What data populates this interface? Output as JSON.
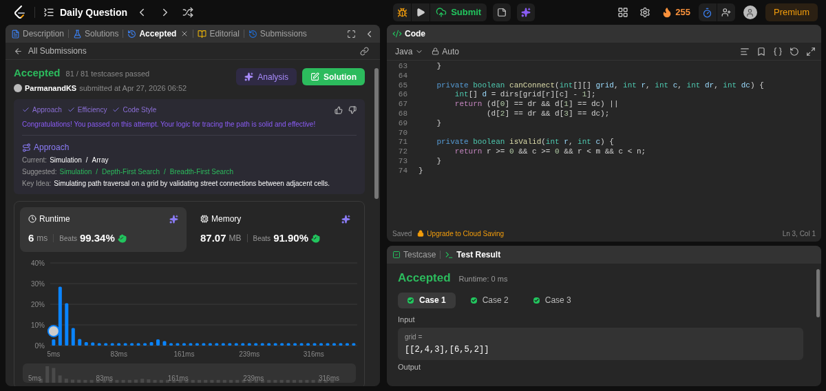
{
  "navbar": {
    "title": "Daily Question",
    "submit": "Submit",
    "streak": "255",
    "premium": "Premium"
  },
  "left_tabs": [
    {
      "label": "Description",
      "kind": "description",
      "selected": false,
      "closable": false
    },
    {
      "label": "Solutions",
      "kind": "solutions",
      "selected": false,
      "closable": false
    },
    {
      "label": "Accepted",
      "kind": "accepted",
      "selected": true,
      "closable": true
    },
    {
      "label": "Editorial",
      "kind": "editorial",
      "selected": false,
      "closable": false
    },
    {
      "label": "Submissions",
      "kind": "submissions",
      "selected": false,
      "closable": false
    }
  ],
  "submission": {
    "back": "All Submissions",
    "status": "Accepted",
    "testcases": "81 / 81 testcases passed",
    "user": "ParmanandKS",
    "submitted": "submitted at Apr 27, 2026 06:52",
    "analysis_button": "Analysis",
    "solution_button": "Solution"
  },
  "feedback": {
    "checks": [
      {
        "label": "Approach",
        "checked": true
      },
      {
        "label": "Efficiency",
        "checked": true
      },
      {
        "label": "Code Style",
        "checked": true
      }
    ],
    "message": "Congratulations! You passed on this attempt. Your logic for tracing the path is solid and effective!",
    "approach_title": "Approach",
    "separator": "/",
    "current_label": "Current:",
    "current": [
      "Simulation",
      "Array"
    ],
    "suggested_label": "Suggested:",
    "suggested": [
      "Simulation",
      "Depth-First Search",
      "Breadth-First Search"
    ],
    "key_idea_label": "Key Idea:",
    "key_idea": "Simulating path traversal on a grid by validating street connections between adjacent cells."
  },
  "stats": [
    {
      "kind": "runtime",
      "label": "Runtime",
      "value": "6",
      "unit": "ms",
      "beats_label": "Beats",
      "beats": "99.34%",
      "selected": true
    },
    {
      "kind": "memory",
      "label": "Memory",
      "value": "87.07",
      "unit": "MB",
      "beats_label": "Beats",
      "beats": "91.90%",
      "selected": false
    }
  ],
  "chart_data": {
    "type": "bar",
    "grid": true,
    "ylim": [
      0,
      40
    ],
    "yticks": [
      {
        "value": 0,
        "label": "0%"
      },
      {
        "value": 10,
        "label": "10%"
      },
      {
        "value": 20,
        "label": "20%"
      },
      {
        "value": 30,
        "label": "30%"
      },
      {
        "value": 40,
        "label": "40%"
      }
    ],
    "xlim": [
      1,
      368
    ],
    "xticks": [
      {
        "value": 5,
        "label": "5ms"
      },
      {
        "value": 83,
        "label": "83ms"
      },
      {
        "value": 161,
        "label": "161ms"
      },
      {
        "value": 239,
        "label": "239ms"
      },
      {
        "value": 316,
        "label": "316ms"
      }
    ],
    "x": [
      5,
      12.8,
      20.6,
      28.4,
      36.2,
      44,
      51.8,
      59.6,
      67.4,
      75.2,
      83,
      90.8,
      98.6,
      106.4,
      114.2,
      122,
      129.8,
      137.6,
      145.4,
      153.2,
      161,
      168.8,
      176.6,
      184.4,
      192.2,
      200,
      207.8,
      215.6,
      223.4,
      231.2,
      239,
      246.8,
      254.6,
      262.4,
      270.2,
      278,
      285.8,
      293.6,
      301.4,
      309.2,
      317,
      324.8,
      332.6,
      340.4,
      348.2,
      356,
      363.8
    ],
    "values": [
      3,
      28.5,
      20.5,
      8.5,
      3.2,
      1.7,
      1.5,
      1.2,
      1.2,
      1.2,
      1.2,
      1.2,
      1.2,
      1.2,
      1.2,
      1.7,
      3,
      2.2,
      1.2,
      1.2,
      1.2,
      1.2,
      1.2,
      1.2,
      1.2,
      1.2,
      1.2,
      1.2,
      1.2,
      1.2,
      1.2,
      1.2,
      1.2,
      1.2,
      1.2,
      1.2,
      1.2,
      1.2,
      1.2,
      1.2,
      1.2,
      1.2,
      1.2,
      1.2,
      1.2,
      1.2,
      1.2
    ]
  },
  "overview_labels": [
    "5ms",
    "83ms",
    "161ms",
    "239ms",
    "316ms"
  ],
  "code": {
    "title": "Code",
    "language": "Java",
    "mode": "Auto",
    "saved": "Saved",
    "upgrade": "Upgrade to Cloud Saving",
    "position": "Ln 3, Col 1",
    "lines": [
      {
        "n": "63",
        "tokens": [
          {
            "t": "    }",
            "kind": "p"
          }
        ]
      },
      {
        "n": "64"
      },
      {
        "n": "65",
        "tokens": [
          {
            "t": "    private ",
            "kind": "kw"
          },
          {
            "t": "boolean ",
            "kind": "type"
          },
          {
            "t": "canConnect",
            "kind": "fn"
          },
          {
            "t": "(",
            "kind": "p"
          },
          {
            "t": "int",
            "kind": "type"
          },
          {
            "t": "[][] ",
            "kind": "p"
          },
          {
            "t": "grid",
            "kind": "var"
          },
          {
            "t": ", ",
            "kind": "p"
          },
          {
            "t": "int ",
            "kind": "type"
          },
          {
            "t": "r",
            "kind": "var"
          },
          {
            "t": ", ",
            "kind": "p"
          },
          {
            "t": "int ",
            "kind": "type"
          },
          {
            "t": "c",
            "kind": "var"
          },
          {
            "t": ", ",
            "kind": "p"
          },
          {
            "t": "int ",
            "kind": "type"
          },
          {
            "t": "dr",
            "kind": "var"
          },
          {
            "t": ", ",
            "kind": "p"
          },
          {
            "t": "int ",
            "kind": "type"
          },
          {
            "t": "dc",
            "kind": "var"
          },
          {
            "t": ") {",
            "kind": "p"
          }
        ]
      },
      {
        "n": "66",
        "tokens": [
          {
            "t": "        int",
            "kind": "type"
          },
          {
            "t": "[] ",
            "kind": "p"
          },
          {
            "t": "d",
            "kind": "var"
          },
          {
            "t": " = dirs[grid[r][c] - ",
            "kind": "p"
          },
          {
            "t": "1",
            "kind": "num"
          },
          {
            "t": "];",
            "kind": "p"
          }
        ]
      },
      {
        "n": "67",
        "tokens": [
          {
            "t": "        return ",
            "kind": "ctl"
          },
          {
            "t": "(d[",
            "kind": "p"
          },
          {
            "t": "0",
            "kind": "num"
          },
          {
            "t": "] == dr && d[",
            "kind": "p"
          },
          {
            "t": "1",
            "kind": "num"
          },
          {
            "t": "] == dc) ||",
            "kind": "p"
          }
        ]
      },
      {
        "n": "68",
        "tokens": [
          {
            "t": "               (d[",
            "kind": "p"
          },
          {
            "t": "2",
            "kind": "num"
          },
          {
            "t": "] == dr && d[",
            "kind": "p"
          },
          {
            "t": "3",
            "kind": "num"
          },
          {
            "t": "] == dc);",
            "kind": "p"
          }
        ]
      },
      {
        "n": "69",
        "tokens": [
          {
            "t": "    }",
            "kind": "p"
          }
        ]
      },
      {
        "n": "70"
      },
      {
        "n": "71",
        "tokens": [
          {
            "t": "    private ",
            "kind": "kw"
          },
          {
            "t": "boolean ",
            "kind": "type"
          },
          {
            "t": "isValid",
            "kind": "fn"
          },
          {
            "t": "(",
            "kind": "p"
          },
          {
            "t": "int ",
            "kind": "type"
          },
          {
            "t": "r",
            "kind": "var"
          },
          {
            "t": ", ",
            "kind": "p"
          },
          {
            "t": "int ",
            "kind": "type"
          },
          {
            "t": "c",
            "kind": "var"
          },
          {
            "t": ") {",
            "kind": "p"
          }
        ]
      },
      {
        "n": "72",
        "tokens": [
          {
            "t": "        return ",
            "kind": "ctl"
          },
          {
            "t": "r >= ",
            "kind": "p"
          },
          {
            "t": "0",
            "kind": "num"
          },
          {
            "t": " && c >= ",
            "kind": "p"
          },
          {
            "t": "0",
            "kind": "num"
          },
          {
            "t": " && r < m && c < n;",
            "kind": "p"
          }
        ]
      },
      {
        "n": "73",
        "tokens": [
          {
            "t": "    }",
            "kind": "p"
          }
        ]
      },
      {
        "n": "74",
        "tokens": [
          {
            "t": "}",
            "kind": "p"
          }
        ]
      }
    ]
  },
  "test": {
    "tabs": [
      {
        "label": "Testcase",
        "kind": "testcase",
        "selected": false
      },
      {
        "label": "Test Result",
        "kind": "result",
        "selected": true
      }
    ],
    "status": "Accepted",
    "runtime": "Runtime: 0 ms",
    "cases": [
      {
        "label": "Case 1",
        "selected": true,
        "passed": true
      },
      {
        "label": "Case 2",
        "selected": false,
        "passed": true
      },
      {
        "label": "Case 3",
        "selected": false,
        "passed": true
      }
    ],
    "input_label": "Input",
    "param": "grid =",
    "value": "[[2,4,3],[6,5,2]]",
    "output_label": "Output"
  }
}
